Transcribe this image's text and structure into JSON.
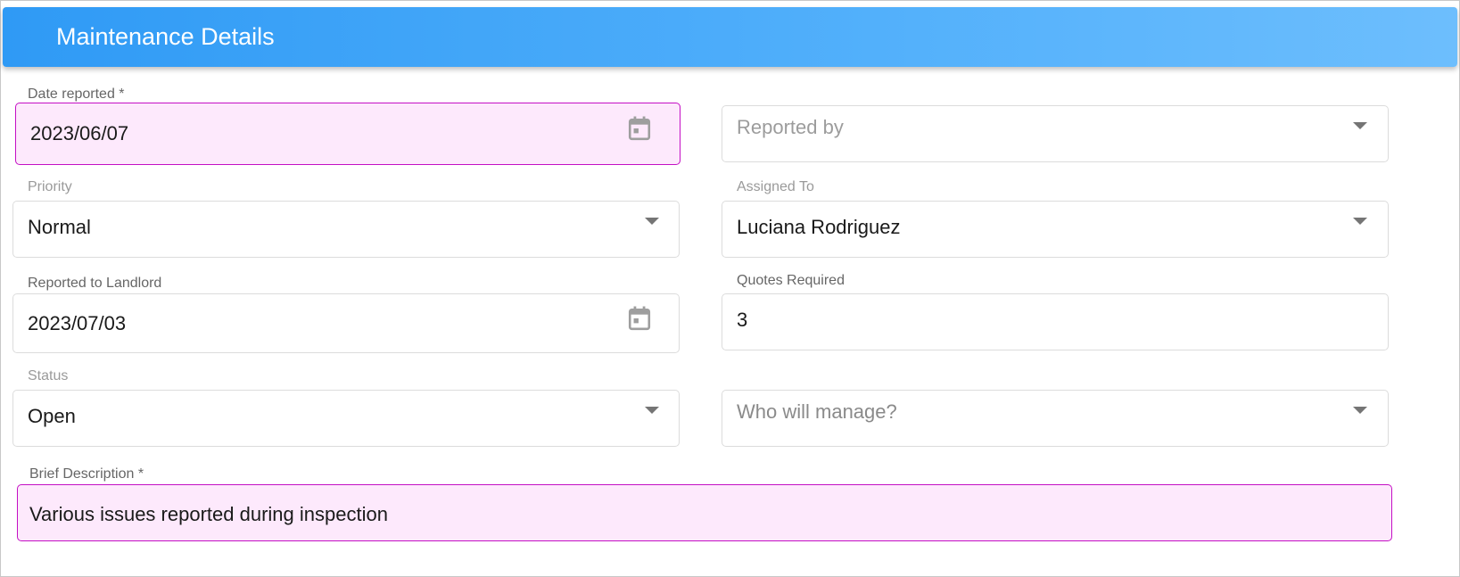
{
  "header": {
    "title": "Maintenance Details"
  },
  "fields": {
    "date_reported": {
      "label": "Date reported *",
      "value": "2023/06/07",
      "icon": "calendar-icon"
    },
    "reported_by": {
      "placeholder": "Reported by",
      "icon": "chevron-down-icon"
    },
    "priority": {
      "label": "Priority",
      "value": "Normal",
      "icon": "chevron-down-icon"
    },
    "assigned_to": {
      "label": "Assigned To",
      "value": "Luciana Rodriguez",
      "icon": "chevron-down-icon"
    },
    "reported_to_landlord": {
      "label": "Reported to Landlord",
      "value": "2023/07/03",
      "icon": "calendar-icon"
    },
    "quotes_required": {
      "label": "Quotes Required",
      "value": "3"
    },
    "status": {
      "label": "Status",
      "value": "Open",
      "icon": "chevron-down-icon"
    },
    "who_will_manage": {
      "placeholder": "Who will manage?",
      "icon": "chevron-down-icon"
    },
    "brief_description": {
      "label": "Brief Description *",
      "value": "Various issues reported during inspection"
    }
  },
  "colors": {
    "header_gradient_start": "#2f9af5",
    "header_gradient_end": "#6dbefd",
    "highlight_fill": "#fde9fc",
    "highlight_border": "#c40fc4"
  }
}
